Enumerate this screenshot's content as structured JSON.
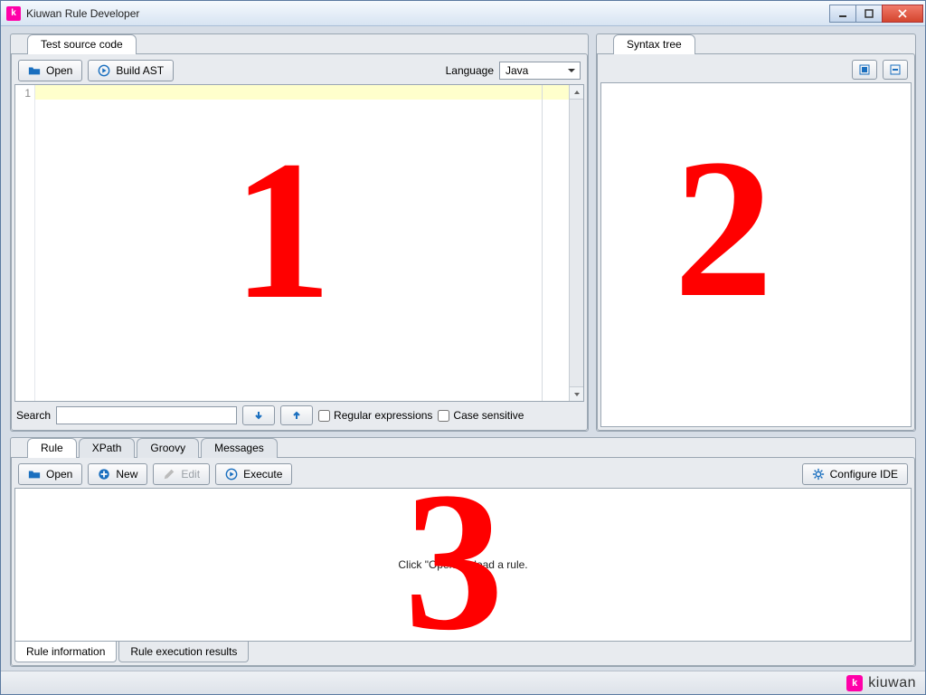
{
  "window": {
    "title": "Kiuwan Rule Developer"
  },
  "source_panel": {
    "tab": "Test source code",
    "open_btn": "Open",
    "build_btn": "Build AST",
    "language_label": "Language",
    "language_value": "Java",
    "line_number": "1",
    "search_label": "Search",
    "regex_label": "Regular expressions",
    "case_label": "Case sensitive"
  },
  "syntax_panel": {
    "tab": "Syntax tree"
  },
  "rule_panel": {
    "tabs": [
      "Rule",
      "XPath",
      "Groovy",
      "Messages"
    ],
    "open_btn": "Open",
    "new_btn": "New",
    "edit_btn": "Edit",
    "execute_btn": "Execute",
    "configure_btn": "Configure IDE",
    "placeholder": "Click \"Open\" to load a rule.",
    "bottom_tabs": [
      "Rule information",
      "Rule execution results"
    ]
  },
  "footer": {
    "brand": "kiuwan"
  },
  "overlays": {
    "one": "1",
    "two": "2",
    "three": "3"
  }
}
